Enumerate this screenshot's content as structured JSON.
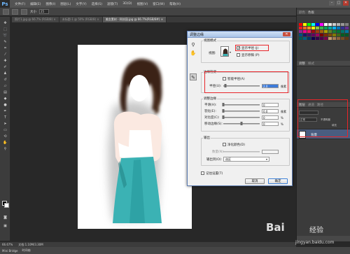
{
  "app": {
    "logo": "Ps"
  },
  "menu": [
    "文件(F)",
    "编辑(E)",
    "图像(I)",
    "图层(L)",
    "文字(Y)",
    "选择(S)",
    "滤镜(T)",
    "3D(D)",
    "视图(V)",
    "窗口(W)",
    "帮助(H)"
  ],
  "window_controls": {
    "minimize": "–",
    "maximize": "□",
    "close": "✕"
  },
  "options_bar": {
    "size_label": "大小",
    "size_value": "25",
    "workspace": "基本功能"
  },
  "doc_tabs": [
    {
      "label": "照片1.jpg @ 66.7% (RGB/8) ×",
      "active": false
    },
    {
      "label": "未标题-1 @ 50% (RGB/8) ×",
      "active": false
    },
    {
      "label": "美女素材 - 科技园.jpg @ 66.7%(RGB/8#) ×",
      "active": true
    }
  ],
  "status_bar": {
    "zoom": "66.67%",
    "doc_info": "文档:1.10M/3.30M"
  },
  "mini_bridge": {
    "tabs": [
      "Mini Bridge",
      "时间轴"
    ]
  },
  "right_panels": {
    "top_tabs": [
      "颜色",
      "色板"
    ],
    "mid_tabs": [
      "调整",
      "样式"
    ],
    "layers_tabs": [
      "图层",
      "通道",
      "路径"
    ],
    "blend_mode": "正常",
    "opacity_label": "不透明度",
    "fill_label": "填充",
    "layer_name": "背景"
  },
  "swatch_colors": [
    "#ff0000",
    "#ffff00",
    "#00ff00",
    "#00ffff",
    "#0000ff",
    "#ff00ff",
    "#ffffff",
    "#e6e6e6",
    "#cccccc",
    "#b3b3b3",
    "#999999",
    "#808080",
    "#ed1c24",
    "#f26522",
    "#f7941d",
    "#fff200",
    "#8dc63f",
    "#39b54a",
    "#00a651",
    "#00a99d",
    "#00aeef",
    "#0072bc",
    "#2e3192",
    "#662d91",
    "#92278f",
    "#ec008c",
    "#ed145b",
    "#9e0b0f",
    "#a0410d",
    "#a3620a",
    "#aba000",
    "#598527",
    "#197b30",
    "#007236",
    "#00746b",
    "#0076a3",
    "#004b80",
    "#1b1464",
    "#440e62",
    "#630460",
    "#9e005d",
    "#790000",
    "#7b2e00",
    "#7d4900",
    "#827b00",
    "#406618",
    "#005e20",
    "#005826",
    "#005952",
    "#005b7f",
    "#003663",
    "#0d004c",
    "#32004b",
    "#4b0049",
    "#7b0046",
    "#c69c6d",
    "#a67c52",
    "#8c6239",
    "#754c24",
    "#603913"
  ],
  "dialog": {
    "title": "调整边缘",
    "close": "✕",
    "view_mode": {
      "section": "视图模式",
      "view_label": "视图:",
      "show_radius": "显示半径 (J)",
      "show_radius_checked": true,
      "show_original": "显示原稿 (P)",
      "show_original_checked": false
    },
    "edge_detection": {
      "section": "边缘检测",
      "smart_radius": "智能半径(A)",
      "smart_radius_checked": false,
      "radius_label": "半径(U):",
      "radius_value": "2.0",
      "radius_unit": "像素",
      "radius_fraction": 0.05
    },
    "adjust_edge": {
      "section": "调整边缘",
      "rows": [
        {
          "label": "平滑(H):",
          "value": "0",
          "unit": "",
          "fraction": 0.0
        },
        {
          "label": "羽化(E):",
          "value": "0.0",
          "unit": "像素",
          "fraction": 0.0
        },
        {
          "label": "对比度(C):",
          "value": "0",
          "unit": "%",
          "fraction": 0.0
        },
        {
          "label": "移动边缘(S):",
          "value": "0",
          "unit": "%",
          "fraction": 0.5
        }
      ]
    },
    "output": {
      "section": "输出",
      "decontaminate": "净化颜色(D)",
      "decontaminate_checked": false,
      "amount_label": "数量(N):",
      "output_to_label": "输出到(O):",
      "output_to_value": "选区"
    },
    "remember": "记住设置(T)",
    "remember_checked": false,
    "cancel": "取消",
    "ok": "确定"
  },
  "highlight_color": "#e8262a",
  "watermark": {
    "brand": "Bai",
    "brand2": "经验",
    "url": "jingyan.baidu.com"
  }
}
